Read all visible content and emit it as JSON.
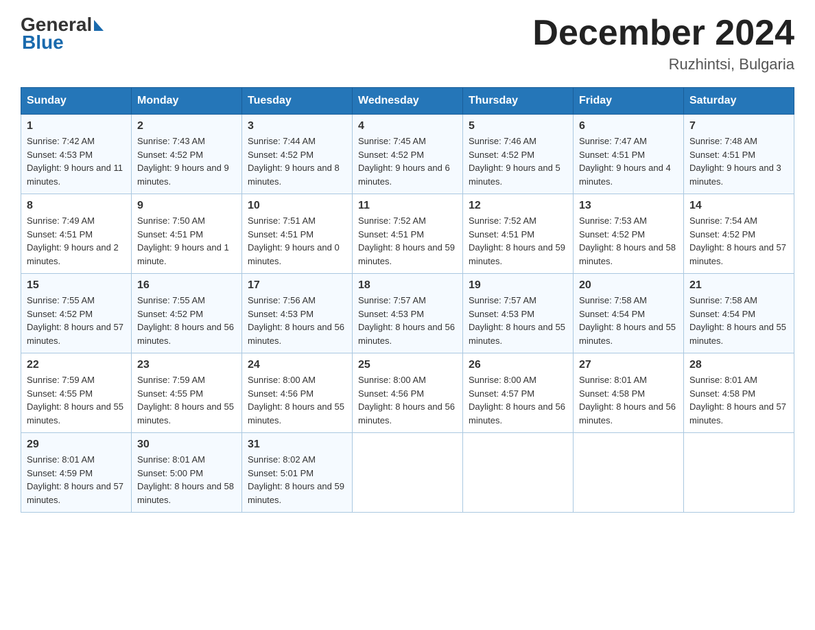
{
  "header": {
    "logo_general": "General",
    "logo_blue": "Blue",
    "month_title": "December 2024",
    "location": "Ruzhintsi, Bulgaria"
  },
  "columns": [
    "Sunday",
    "Monday",
    "Tuesday",
    "Wednesday",
    "Thursday",
    "Friday",
    "Saturday"
  ],
  "weeks": [
    [
      {
        "day": "1",
        "sunrise": "7:42 AM",
        "sunset": "4:53 PM",
        "daylight": "9 hours and 11 minutes."
      },
      {
        "day": "2",
        "sunrise": "7:43 AM",
        "sunset": "4:52 PM",
        "daylight": "9 hours and 9 minutes."
      },
      {
        "day": "3",
        "sunrise": "7:44 AM",
        "sunset": "4:52 PM",
        "daylight": "9 hours and 8 minutes."
      },
      {
        "day": "4",
        "sunrise": "7:45 AM",
        "sunset": "4:52 PM",
        "daylight": "9 hours and 6 minutes."
      },
      {
        "day": "5",
        "sunrise": "7:46 AM",
        "sunset": "4:52 PM",
        "daylight": "9 hours and 5 minutes."
      },
      {
        "day": "6",
        "sunrise": "7:47 AM",
        "sunset": "4:51 PM",
        "daylight": "9 hours and 4 minutes."
      },
      {
        "day": "7",
        "sunrise": "7:48 AM",
        "sunset": "4:51 PM",
        "daylight": "9 hours and 3 minutes."
      }
    ],
    [
      {
        "day": "8",
        "sunrise": "7:49 AM",
        "sunset": "4:51 PM",
        "daylight": "9 hours and 2 minutes."
      },
      {
        "day": "9",
        "sunrise": "7:50 AM",
        "sunset": "4:51 PM",
        "daylight": "9 hours and 1 minute."
      },
      {
        "day": "10",
        "sunrise": "7:51 AM",
        "sunset": "4:51 PM",
        "daylight": "9 hours and 0 minutes."
      },
      {
        "day": "11",
        "sunrise": "7:52 AM",
        "sunset": "4:51 PM",
        "daylight": "8 hours and 59 minutes."
      },
      {
        "day": "12",
        "sunrise": "7:52 AM",
        "sunset": "4:51 PM",
        "daylight": "8 hours and 59 minutes."
      },
      {
        "day": "13",
        "sunrise": "7:53 AM",
        "sunset": "4:52 PM",
        "daylight": "8 hours and 58 minutes."
      },
      {
        "day": "14",
        "sunrise": "7:54 AM",
        "sunset": "4:52 PM",
        "daylight": "8 hours and 57 minutes."
      }
    ],
    [
      {
        "day": "15",
        "sunrise": "7:55 AM",
        "sunset": "4:52 PM",
        "daylight": "8 hours and 57 minutes."
      },
      {
        "day": "16",
        "sunrise": "7:55 AM",
        "sunset": "4:52 PM",
        "daylight": "8 hours and 56 minutes."
      },
      {
        "day": "17",
        "sunrise": "7:56 AM",
        "sunset": "4:53 PM",
        "daylight": "8 hours and 56 minutes."
      },
      {
        "day": "18",
        "sunrise": "7:57 AM",
        "sunset": "4:53 PM",
        "daylight": "8 hours and 56 minutes."
      },
      {
        "day": "19",
        "sunrise": "7:57 AM",
        "sunset": "4:53 PM",
        "daylight": "8 hours and 55 minutes."
      },
      {
        "day": "20",
        "sunrise": "7:58 AM",
        "sunset": "4:54 PM",
        "daylight": "8 hours and 55 minutes."
      },
      {
        "day": "21",
        "sunrise": "7:58 AM",
        "sunset": "4:54 PM",
        "daylight": "8 hours and 55 minutes."
      }
    ],
    [
      {
        "day": "22",
        "sunrise": "7:59 AM",
        "sunset": "4:55 PM",
        "daylight": "8 hours and 55 minutes."
      },
      {
        "day": "23",
        "sunrise": "7:59 AM",
        "sunset": "4:55 PM",
        "daylight": "8 hours and 55 minutes."
      },
      {
        "day": "24",
        "sunrise": "8:00 AM",
        "sunset": "4:56 PM",
        "daylight": "8 hours and 55 minutes."
      },
      {
        "day": "25",
        "sunrise": "8:00 AM",
        "sunset": "4:56 PM",
        "daylight": "8 hours and 56 minutes."
      },
      {
        "day": "26",
        "sunrise": "8:00 AM",
        "sunset": "4:57 PM",
        "daylight": "8 hours and 56 minutes."
      },
      {
        "day": "27",
        "sunrise": "8:01 AM",
        "sunset": "4:58 PM",
        "daylight": "8 hours and 56 minutes."
      },
      {
        "day": "28",
        "sunrise": "8:01 AM",
        "sunset": "4:58 PM",
        "daylight": "8 hours and 57 minutes."
      }
    ],
    [
      {
        "day": "29",
        "sunrise": "8:01 AM",
        "sunset": "4:59 PM",
        "daylight": "8 hours and 57 minutes."
      },
      {
        "day": "30",
        "sunrise": "8:01 AM",
        "sunset": "5:00 PM",
        "daylight": "8 hours and 58 minutes."
      },
      {
        "day": "31",
        "sunrise": "8:02 AM",
        "sunset": "5:01 PM",
        "daylight": "8 hours and 59 minutes."
      },
      null,
      null,
      null,
      null
    ]
  ],
  "labels": {
    "sunrise": "Sunrise:",
    "sunset": "Sunset:",
    "daylight": "Daylight:"
  }
}
